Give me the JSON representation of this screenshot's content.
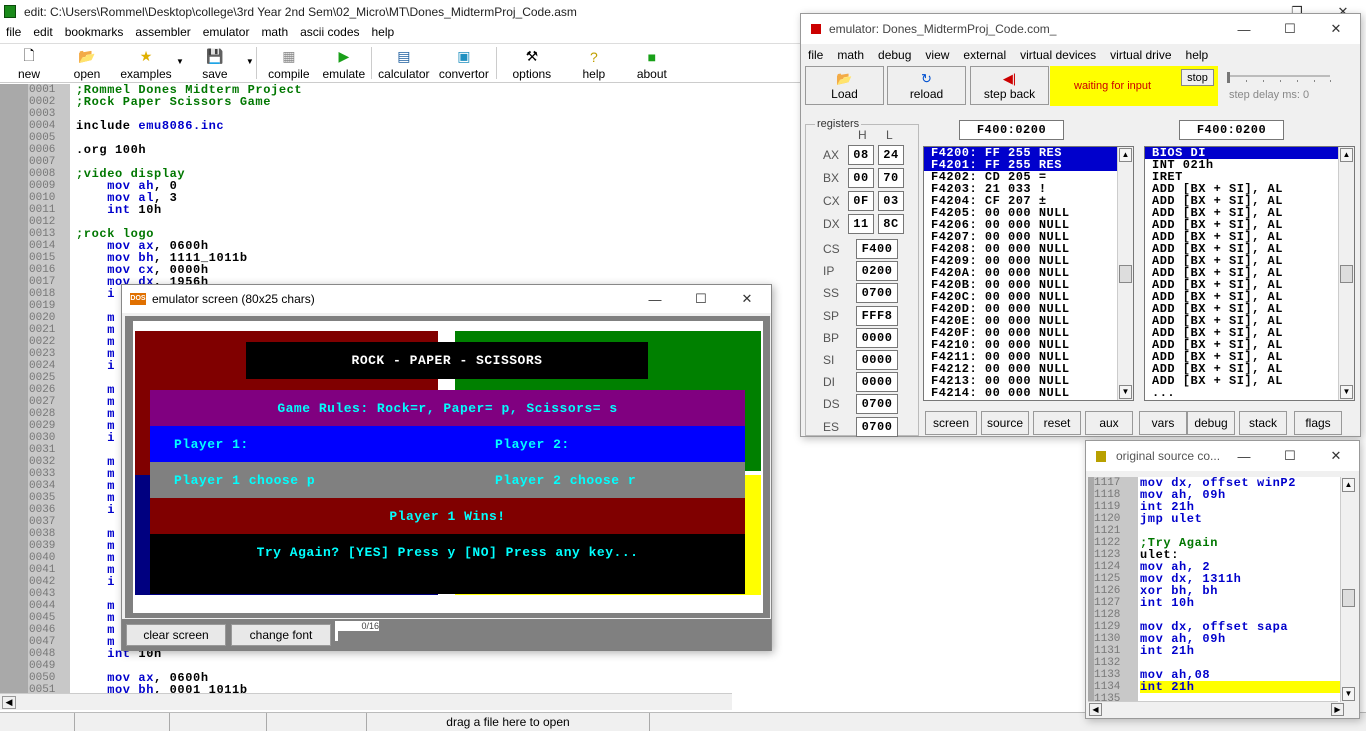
{
  "editor": {
    "title": "edit: C:\\Users\\Rommel\\Desktop\\college\\3rd Year 2nd Sem\\02_Micro\\MT\\Dones_MidtermProj_Code.asm",
    "menu": [
      "file",
      "edit",
      "bookmarks",
      "assembler",
      "emulator",
      "math",
      "ascii codes",
      "help"
    ],
    "toolbar": {
      "new": "new",
      "open": "open",
      "examples": "examples",
      "save": "save",
      "compile": "compile",
      "emulate": "emulate",
      "calculator": "calculator",
      "convertor": "convertor",
      "options": "options",
      "help": "help",
      "about": "about"
    },
    "line_numbers": [
      "0001",
      "0002",
      "0003",
      "0004",
      "0005",
      "0006",
      "0007",
      "0008",
      "0009",
      "0010",
      "0011",
      "0012",
      "0013",
      "0014",
      "0015",
      "0016",
      "0017",
      "0018",
      "0019",
      "0020",
      "0021",
      "0022",
      "0023",
      "0024",
      "0025",
      "0026",
      "0027",
      "0028",
      "0029",
      "0030",
      "0031",
      "0032",
      "0033",
      "0034",
      "0035",
      "0036",
      "0037",
      "0038",
      "0039",
      "0040",
      "0041",
      "0042",
      "0043",
      "0044",
      "0045",
      "0046",
      "0047",
      "0048",
      "0049",
      "0050",
      "0051"
    ],
    "code": {
      "l1": ";Rommel Dones Midterm Project",
      "l2": ";Rock Paper Scissors Game",
      "l4a": "include ",
      "l4b": "emu8086.inc",
      "l6": ".org 100h",
      "l8": ";video display",
      "l9a": "    mov ",
      "l9b": "ah",
      "l9c": ", 0",
      "l10a": "    mov ",
      "l10b": "al",
      "l10c": ", 3",
      "l11a": "    int ",
      "l11b": "10h",
      "l13": ";rock logo",
      "l14a": "    mov ",
      "l14b": "ax",
      "l14c": ", 0600h",
      "l15a": "    mov ",
      "l15b": "bh",
      "l15c": ", 1111_1011b",
      "l16a": "    mov ",
      "l16b": "cx",
      "l16c": ", 0000h",
      "l17a": "    mov ",
      "l17b": "dx",
      "l17c": ", 1956h",
      "l18": "    i",
      "l_m": "    m",
      "l_i": "    i",
      "l48a": "    int ",
      "l48b": "10h",
      "l50a": "    mov ",
      "l50b": "ax",
      "l50c": ", 0600h",
      "l51a": "    mov ",
      "l51b": "bh",
      "l51c": ", 0001_1011b"
    },
    "status": {
      "drag": "drag a file here to open"
    }
  },
  "emu_screen": {
    "title": "emulator screen (80x25 chars)",
    "banner": "ROCK - PAPER - SCISSORS",
    "rules": "Game Rules: Rock=r, Paper= p, Scissors= s",
    "p1": "Player 1:",
    "p2": "Player 2:",
    "p1choose": "Player 1 choose p",
    "p2choose": "Player 2 choose r",
    "result": "Player 1 Wins!",
    "again": "Try Again? [YES] Press y [NO] Press any key...",
    "clear": "clear screen",
    "font": "change font",
    "counter": "0/16"
  },
  "emulator": {
    "title": "emulator: Dones_MidtermProj_Code.com_",
    "menu": [
      "file",
      "math",
      "debug",
      "view",
      "external",
      "virtual devices",
      "virtual drive",
      "help"
    ],
    "load": "Load",
    "reload": "reload",
    "stepback": "step back",
    "waiting": "waiting for input",
    "stop": "stop",
    "stepdelay": "step delay ms: 0",
    "registers_label": "registers",
    "h": "H",
    "l": "L",
    "regs": [
      {
        "name": "AX",
        "h": "08",
        "l": "24"
      },
      {
        "name": "BX",
        "h": "00",
        "l": "70"
      },
      {
        "name": "CX",
        "h": "0F",
        "l": "03"
      },
      {
        "name": "DX",
        "h": "11",
        "l": "8C"
      }
    ],
    "sregs": [
      {
        "name": "CS",
        "v": "F400"
      },
      {
        "name": "IP",
        "v": "0200"
      },
      {
        "name": "SS",
        "v": "0700"
      },
      {
        "name": "SP",
        "v": "FFF8"
      },
      {
        "name": "BP",
        "v": "0000"
      },
      {
        "name": "SI",
        "v": "0000"
      },
      {
        "name": "DI",
        "v": "0000"
      },
      {
        "name": "DS",
        "v": "0700"
      },
      {
        "name": "ES",
        "v": "0700"
      }
    ],
    "addr1": "F400:0200",
    "addr2": "F400:0200",
    "mem": [
      "F4200: FF 255 RES",
      "F4201: FF 255 RES",
      "F4202: CD 205 =",
      "F4203: 21 033 !",
      "F4204: CF 207 ±",
      "F4205: 00 000 NULL",
      "F4206: 00 000 NULL",
      "F4207: 00 000 NULL",
      "F4208: 00 000 NULL",
      "F4209: 00 000 NULL",
      "F420A: 00 000 NULL",
      "F420B: 00 000 NULL",
      "F420C: 00 000 NULL",
      "F420D: 00 000 NULL",
      "F420E: 00 000 NULL",
      "F420F: 00 000 NULL",
      "F4210: 00 000 NULL",
      "F4211: 00 000 NULL",
      "F4212: 00 000 NULL",
      "F4213: 00 000 NULL",
      "F4214: 00 000 NULL"
    ],
    "dis": [
      "BIOS DI",
      "INT 021h",
      "IRET",
      "ADD [BX + SI], AL",
      "ADD [BX + SI], AL",
      "ADD [BX + SI], AL",
      "ADD [BX + SI], AL",
      "ADD [BX + SI], AL",
      "ADD [BX + SI], AL",
      "ADD [BX + SI], AL",
      "ADD [BX + SI], AL",
      "ADD [BX + SI], AL",
      "ADD [BX + SI], AL",
      "ADD [BX + SI], AL",
      "ADD [BX + SI], AL",
      "ADD [BX + SI], AL",
      "ADD [BX + SI], AL",
      "ADD [BX + SI], AL",
      "ADD [BX + SI], AL",
      "ADD [BX + SI], AL",
      "..."
    ],
    "bottom": [
      "screen",
      "source",
      "reset",
      "aux",
      "vars",
      "debug",
      "stack",
      "flags"
    ]
  },
  "source": {
    "title": "original source co...",
    "nums": [
      "1117",
      "1118",
      "1119",
      "1120",
      "1121",
      "1122",
      "1123",
      "1124",
      "1125",
      "1126",
      "1127",
      "1128",
      "1129",
      "1130",
      "1131",
      "1132",
      "1133",
      "1134",
      "1135"
    ],
    "lines": [
      "mov dx, offset winP2",
      "mov ah, 09h",
      "int 21h",
      "jmp ulet",
      "",
      ";Try Again",
      "ulet:",
      "mov ah, 2",
      "mov dx, 1311h",
      "xor bh, bh",
      "int 10h",
      "",
      "mov dx, offset sapa",
      "mov ah, 09h",
      "int 21h",
      "",
      "mov ah,08",
      "int 21h",
      ""
    ]
  }
}
